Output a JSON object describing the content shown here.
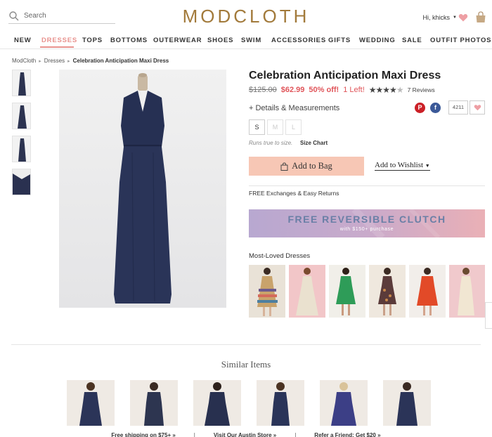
{
  "header": {
    "search_placeholder": "Search",
    "logo": "MODCLOTH",
    "greeting": "Hi, khicks",
    "accent": "#a27a3b",
    "icons": [
      "search-icon",
      "chevron-down-icon",
      "heart-icon",
      "bag-icon"
    ]
  },
  "nav": {
    "items": [
      "NEW",
      "DRESSES",
      "TOPS",
      "BOTTOMS",
      "OUTERWEAR",
      "SHOES",
      "SWIM",
      "ACCESSORIES",
      "GIFTS",
      "WEDDING",
      "SALE",
      "OUTFIT PHOTOS"
    ],
    "active": "DRESSES"
  },
  "breadcrumb": [
    "ModCloth",
    "Dresses",
    "Celebration Anticipation Maxi Dress"
  ],
  "product": {
    "title": "Celebration Anticipation Maxi Dress",
    "old_price": "$125.00",
    "price": "$62.99",
    "discount": "50% off!",
    "stock": "1 Left!",
    "rating": 4,
    "rating_max": 5,
    "reviews": "7 Reviews",
    "details_link": "+ Details & Measurements",
    "pinterest": "P",
    "facebook": "f",
    "wishlist_count": "4211",
    "sizes": [
      {
        "label": "S",
        "available": true
      },
      {
        "label": "M",
        "available": false
      },
      {
        "label": "L",
        "available": false
      }
    ],
    "fit_note": "Runs true to size.",
    "size_chart": "Size Chart",
    "add_to_bag": "Add to Bag",
    "add_to_wishlist": "Add to Wishlist",
    "free_exchanges": "FREE Exchanges & Easy Returns",
    "sale_color": "#e0555a"
  },
  "promo": {
    "title": "FREE REVERSIBLE CLUTCH",
    "subtitle": "with $150+ purchase"
  },
  "most_loved": {
    "heading": "Most-Loved Dresses",
    "count": 6
  },
  "similar": {
    "heading": "Similar Items",
    "count": 6
  },
  "footer": {
    "links": [
      "Free shipping on $75+ »",
      "Visit Our Austin Store »",
      "Refer a Friend: Get $20 »"
    ],
    "separator": "|"
  }
}
